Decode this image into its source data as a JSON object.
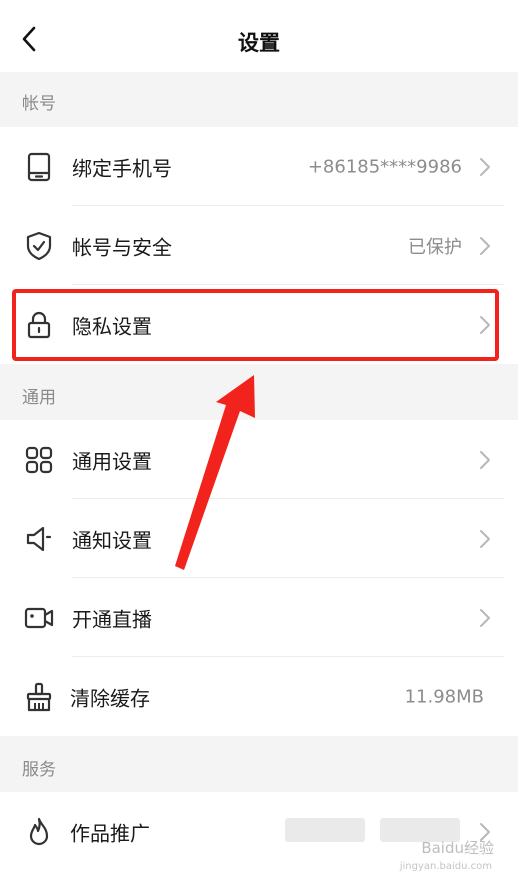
{
  "header": {
    "title": "设置"
  },
  "sections": {
    "account": {
      "label": "帐号",
      "items": [
        {
          "label": "绑定手机号",
          "value": "+86185****9986"
        },
        {
          "label": "帐号与安全",
          "value": "已保护"
        },
        {
          "label": "隐私设置",
          "value": ""
        }
      ]
    },
    "general": {
      "label": "通用",
      "items": [
        {
          "label": "通用设置",
          "value": ""
        },
        {
          "label": "通知设置",
          "value": ""
        },
        {
          "label": "开通直播",
          "value": ""
        },
        {
          "label": "清除缓存",
          "value": "11.98MB"
        }
      ]
    },
    "service": {
      "label": "服务",
      "items": [
        {
          "label": "作品推广",
          "value": ""
        }
      ]
    }
  },
  "watermark": {
    "text": "Baidu经验",
    "sub": "jingyan.baidu.com"
  },
  "colors": {
    "highlight": "#f2221c",
    "text": "#1a1a1a",
    "muted": "#8c8c8c",
    "background": "#f4f4f4"
  }
}
